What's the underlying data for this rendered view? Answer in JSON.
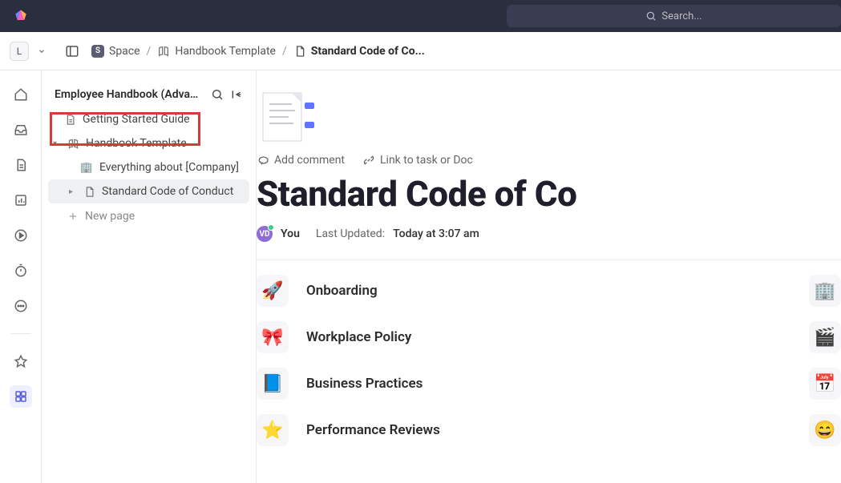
{
  "topbar": {
    "search_placeholder": "Search..."
  },
  "workspace_badge": "L",
  "breadcrumbs": {
    "items": [
      {
        "icon": "S",
        "label": "Space"
      },
      {
        "icon": "book",
        "label": "Handbook Template"
      },
      {
        "icon": "doc",
        "label": "Standard Code of Co..."
      }
    ]
  },
  "sidebar": {
    "title": "Employee Handbook (Advanc...",
    "items": [
      {
        "icon": "doc",
        "label": "Getting Started Guide",
        "level": 1,
        "highlighted": true
      },
      {
        "icon": "book",
        "label": "Handbook Template",
        "level": 1,
        "expanded": true
      },
      {
        "icon": "office",
        "label": "Everything about [Company]",
        "level": 2
      },
      {
        "icon": "doc",
        "label": "Standard Code of Conduct",
        "level": 2,
        "selected": true,
        "has_children": true
      }
    ],
    "new_page": "New page"
  },
  "document": {
    "add_comment": "Add comment",
    "link_task": "Link to task or Doc",
    "title": "Standard Code of Co",
    "author_badge": "VD",
    "author_label": "You",
    "updated_label": "Last Updated:",
    "updated_value": "Today at 3:07 am",
    "sections": [
      {
        "emoji": "🚀",
        "label": "Onboarding",
        "right": "🏢"
      },
      {
        "emoji": "🎀",
        "label": "Workplace Policy",
        "right": "🎬"
      },
      {
        "emoji": "📘",
        "label": "Business Practices",
        "right": "📅"
      },
      {
        "emoji": "⭐",
        "label": "Performance Reviews",
        "right": "😄"
      }
    ]
  }
}
